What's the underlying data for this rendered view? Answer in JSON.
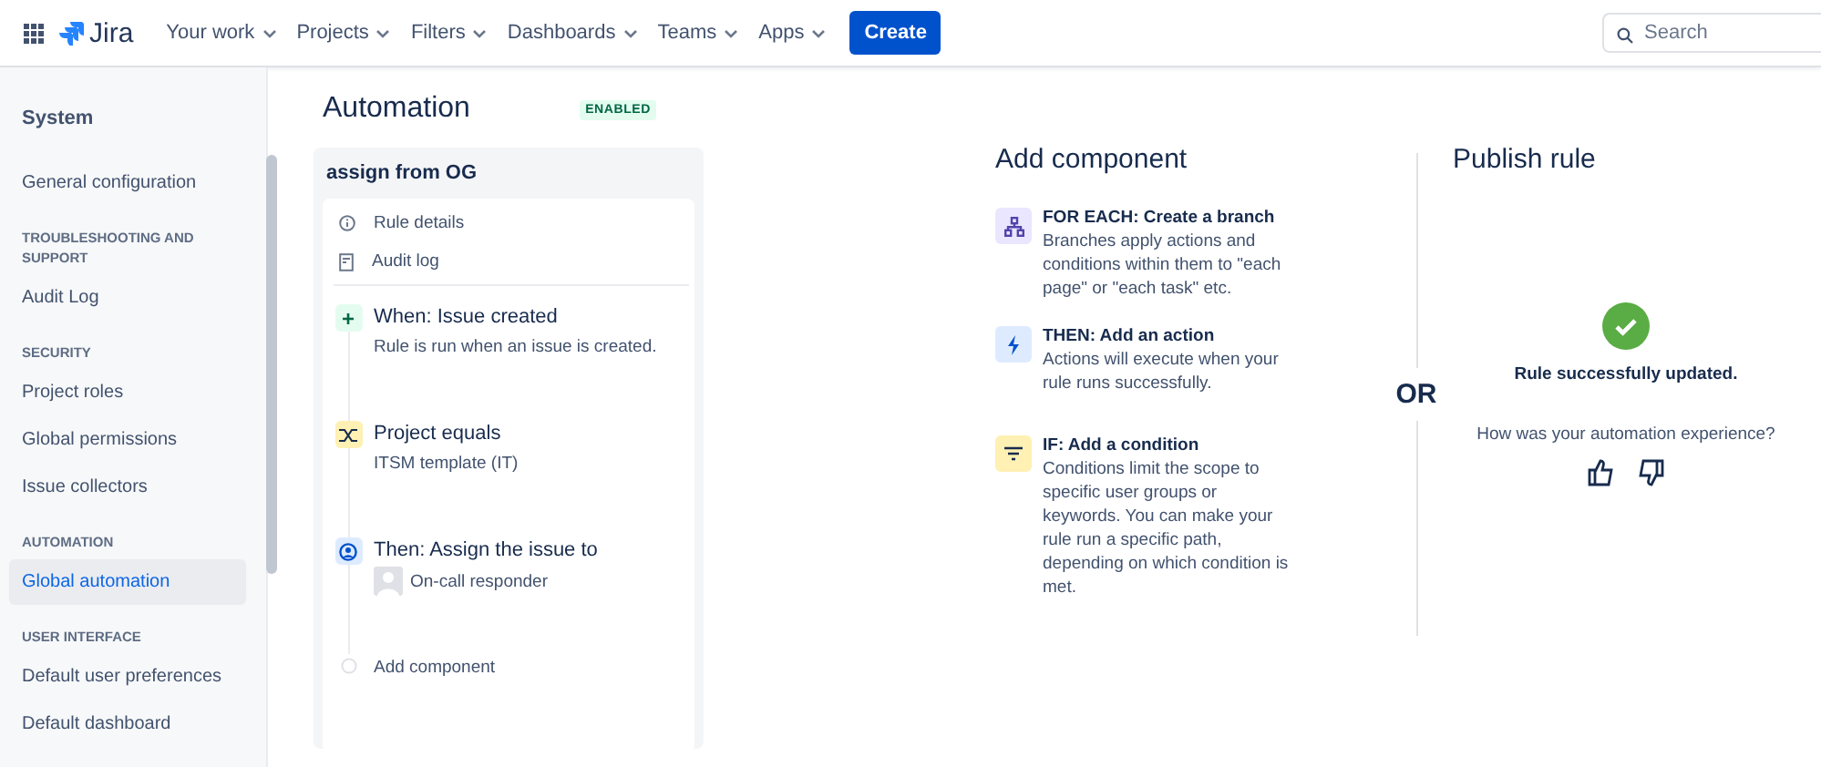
{
  "topbar": {
    "product": "Jira",
    "nav": [
      {
        "label": "Your work"
      },
      {
        "label": "Projects"
      },
      {
        "label": "Filters"
      },
      {
        "label": "Dashboards"
      },
      {
        "label": "Teams"
      },
      {
        "label": "Apps"
      }
    ],
    "create": "Create",
    "search": {
      "placeholder": "Search"
    }
  },
  "sidebar": {
    "title": "System",
    "sections": [
      {
        "items": [
          {
            "label": "General configuration",
            "selected": false
          }
        ]
      },
      {
        "heading": "TROUBLESHOOTING AND SUPPORT",
        "items": [
          {
            "label": "Audit Log",
            "selected": false
          }
        ]
      },
      {
        "heading": "SECURITY",
        "items": [
          {
            "label": "Project roles",
            "selected": false
          },
          {
            "label": "Global permissions",
            "selected": false
          },
          {
            "label": "Issue collectors",
            "selected": false
          }
        ]
      },
      {
        "heading": "AUTOMATION",
        "items": [
          {
            "label": "Global automation",
            "selected": true
          }
        ]
      },
      {
        "heading": "USER INTERFACE",
        "items": [
          {
            "label": "Default user preferences",
            "selected": false
          },
          {
            "label": "Default dashboard",
            "selected": false
          }
        ]
      }
    ]
  },
  "page": {
    "title": "Automation",
    "status": "ENABLED"
  },
  "rule": {
    "name": "assign from OG",
    "links": [
      {
        "kind": "info",
        "label": "Rule details"
      },
      {
        "kind": "log",
        "label": "Audit log"
      }
    ],
    "steps": [
      {
        "kind": "trigger",
        "title": "When: Issue created",
        "detail": "Rule is run when an issue is created."
      },
      {
        "kind": "condition",
        "title": "Project equals",
        "detail": "ITSM template (IT)"
      },
      {
        "kind": "action",
        "title": "Then: Assign the issue to",
        "assignee": "On-call responder"
      },
      {
        "kind": "add",
        "title": "Add component"
      }
    ]
  },
  "add_component": {
    "title": "Add component",
    "options": [
      {
        "kind": "branch",
        "title": "FOR EACH: Create a branch",
        "description": "Branches apply actions and conditions within them to \"each page\" or \"each task\" etc."
      },
      {
        "kind": "action",
        "title": "THEN: Add an action",
        "description": "Actions will execute when your rule runs successfully."
      },
      {
        "kind": "condition",
        "title": "IF: Add a condition",
        "description": "Conditions limit the scope to specific user groups or keywords. You can make your rule run a specific path, depending on which condition is met."
      }
    ]
  },
  "separator": "OR",
  "publish": {
    "title": "Publish rule",
    "message": "Rule successfully updated.",
    "question": "How was your automation experience?"
  }
}
